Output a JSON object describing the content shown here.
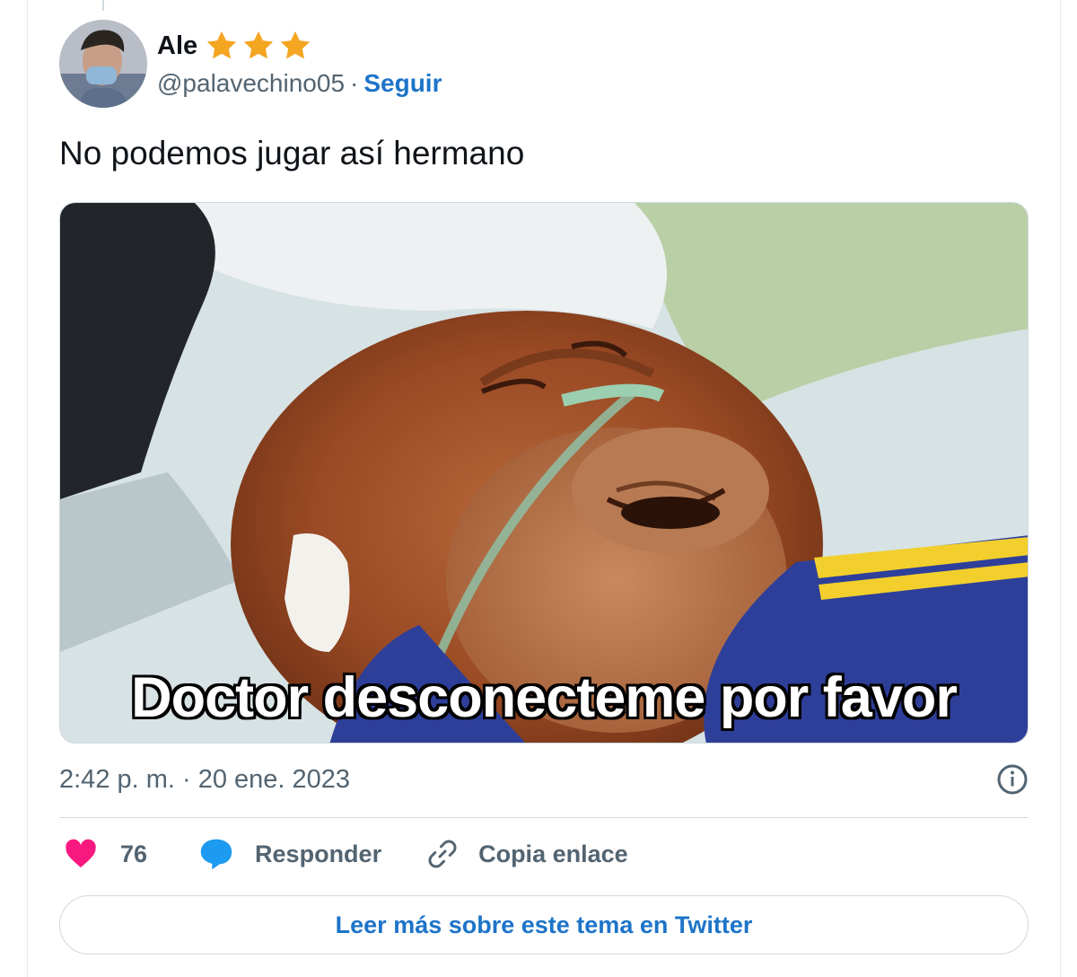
{
  "tweet": {
    "author": {
      "display_name": "Ale",
      "handle": "@palavechino05",
      "separator": "·",
      "follow_label": "Seguir",
      "badge_icons": [
        "star-icon",
        "star-icon",
        "star-icon"
      ]
    },
    "text": "No podemos jugar así hermano",
    "media": {
      "caption": "Doctor desconecteme por favor"
    },
    "timestamp": "2:42 p. m. · 20 ene. 2023",
    "actions": {
      "like_count": "76",
      "reply_label": "Responder",
      "copy_link_label": "Copia enlace"
    },
    "read_more_label": "Leer más sobre este tema en Twitter"
  },
  "colors": {
    "link": "#1d74c9",
    "like": "#f91880",
    "reply": "#1d9bf0",
    "star": "#f4a522",
    "secondary_text": "#536471"
  }
}
